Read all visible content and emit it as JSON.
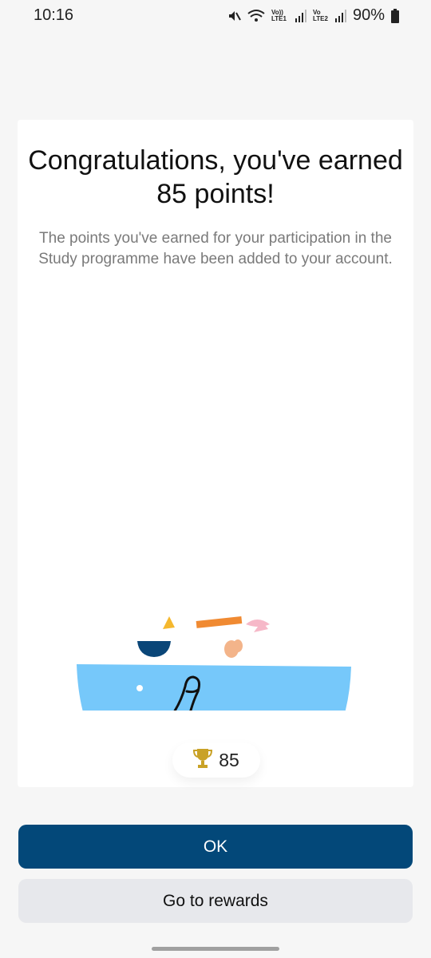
{
  "status_bar": {
    "time": "10:16",
    "sim1_label": "Vo)) LTE1",
    "sim2_label": "Vo LTE2",
    "battery": "90%",
    "icons": [
      "mute-icon",
      "wifi-icon",
      "signal-icon",
      "battery-icon"
    ]
  },
  "dialog": {
    "title": "Congratulations, you've earned 85 points!",
    "message": "The points you've earned for your participation in the Study programme have been added to your account.",
    "illustration_icon": "thumbs-up-bowl-illustration",
    "points": {
      "icon": "trophy-icon",
      "value": "85"
    }
  },
  "actions": {
    "ok_label": "OK",
    "rewards_label": "Go to rewards"
  },
  "colors": {
    "primary": "#034879",
    "bowl": "#76c8fa",
    "trophy": "#c9a227",
    "secondary_button": "#e7e8ec"
  }
}
